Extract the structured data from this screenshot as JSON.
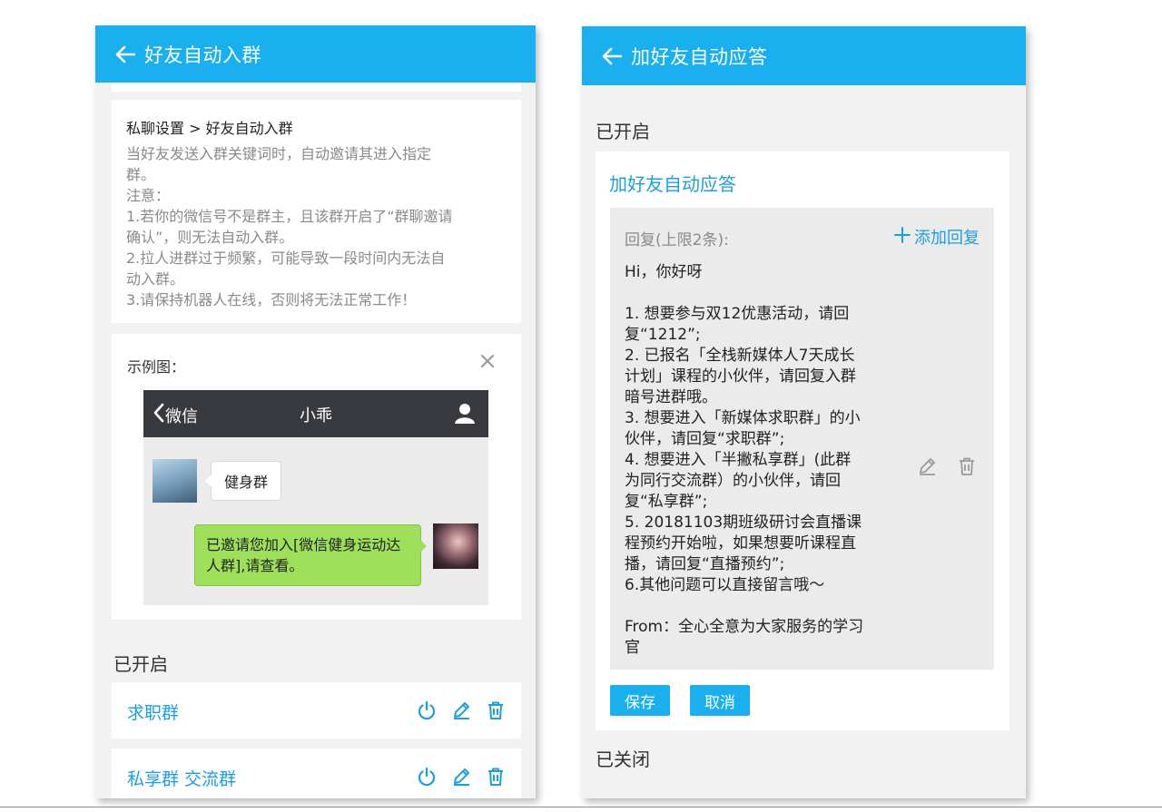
{
  "left": {
    "title": "好友自动入群",
    "breadcrumb": "私聊设置 > 好友自动入群",
    "description": "当好友发送入群关键词时，自动邀请其进入指定\n群。\n注意：\n1.若你的微信号不是群主，且该群开启了“群聊邀请\n确认”，则无法自动入群。\n2.拉人进群过于频繁，可能导致一段时间内无法自\n动入群。\n3.请保持机器人在线，否则将无法正常工作！",
    "example_label": "示例图：",
    "example": {
      "back_label": "微信",
      "chat_title": "小乖",
      "incoming_message": "健身群",
      "outgoing_message": "已邀请您加入[微信健身运动达\n人群],请查看。"
    },
    "enabled_heading": "已开启",
    "groups": [
      {
        "name": "求职群"
      },
      {
        "name": "私享群 交流群"
      }
    ]
  },
  "right": {
    "title": "加好友自动应答",
    "enabled_heading": "已开启",
    "card_title": "加好友自动应答",
    "reply_limit": "回复(上限2条):",
    "add_reply": "添加回复",
    "reply_text": "Hi，你好呀\n\n1. 想要参与双12优惠活动，请回\n复“1212”;\n2. 已报名「全栈新媒体人7天成长\n计划」课程的小伙伴，请回复入群\n暗号进群哦。\n3. 想要进入「新媒体求职群」的小\n伙伴，请回复“求职群”;\n4. 想要进入「半撇私享群」(此群\n为同行交流群）的小伙伴，请回\n复“私享群”;\n5. 20181103期班级研讨会直播课\n程预约开始啦，如果想要听课程直\n播，请回复“直播预约”;\n6.其他问题可以直接留言哦～\n\nFrom：全心全意为大家服务的学习\n官",
    "save_label": "保存",
    "cancel_label": "取消",
    "disabled_heading": "已关闭"
  },
  "colors": {
    "accent": "#1ab0f0",
    "link": "#1a9fe0",
    "chat_bubble_green": "#9fe05a",
    "wechat_bar": "#393a3f"
  },
  "icons": [
    "arrow-left-icon",
    "close-icon",
    "chevron-left-icon",
    "user-icon",
    "power-icon",
    "pencil-icon",
    "trash-icon",
    "plus-icon"
  ]
}
